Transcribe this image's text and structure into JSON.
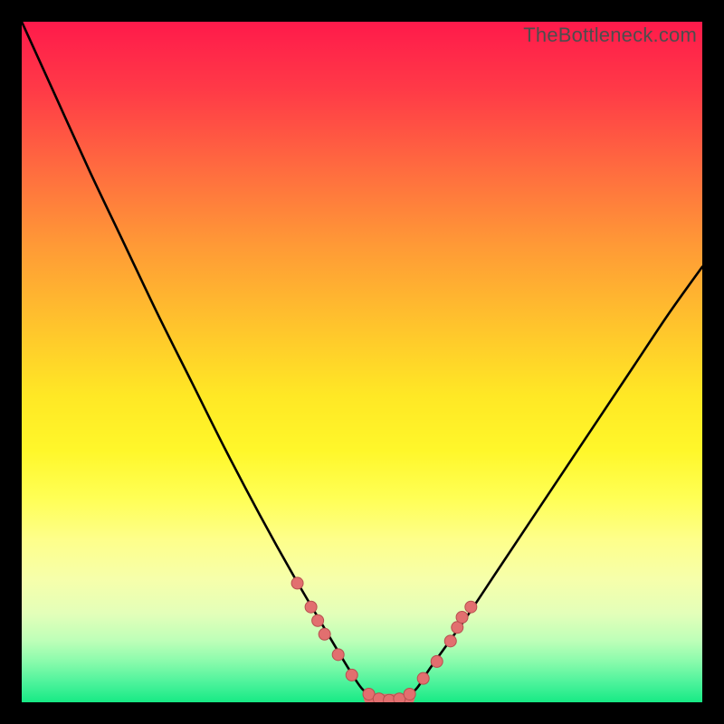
{
  "watermark": "TheBottleneck.com",
  "colors": {
    "frame": "#000000",
    "curve_stroke": "#000000",
    "marker_fill": "#e26f6f",
    "marker_stroke": "#b74f4f"
  },
  "chart_data": {
    "type": "line",
    "title": "",
    "xlabel": "",
    "ylabel": "",
    "xlim": [
      0,
      100
    ],
    "ylim": [
      0,
      100
    ],
    "note": "Axes are percentage-normalized to the plot frame (0=left/bottom, 100=right/top). No tick labels or axis text are present in the image; all numeric values are visual estimates.",
    "series": [
      {
        "name": "bottleneck-curve",
        "x": [
          0,
          5,
          10,
          15,
          20,
          25,
          30,
          35,
          40,
          45,
          48,
          50,
          52,
          54,
          56,
          58,
          60,
          65,
          70,
          75,
          80,
          85,
          90,
          95,
          100
        ],
        "y": [
          100,
          89,
          78,
          67.5,
          57,
          47,
          37,
          27.5,
          18.5,
          10,
          5,
          2,
          0.5,
          0,
          0.5,
          2,
          5,
          12,
          19.5,
          27,
          34.5,
          42,
          49.5,
          57,
          64
        ]
      }
    ],
    "markers": {
      "name": "highlighted-points",
      "points": [
        {
          "x": 40.5,
          "y": 17.5
        },
        {
          "x": 42.5,
          "y": 14
        },
        {
          "x": 43.5,
          "y": 12
        },
        {
          "x": 44.5,
          "y": 10
        },
        {
          "x": 46.5,
          "y": 7
        },
        {
          "x": 48.5,
          "y": 4
        },
        {
          "x": 51,
          "y": 1.2
        },
        {
          "x": 52.5,
          "y": 0.5
        },
        {
          "x": 54,
          "y": 0.3
        },
        {
          "x": 55.5,
          "y": 0.5
        },
        {
          "x": 57,
          "y": 1.2
        },
        {
          "x": 59,
          "y": 3.5
        },
        {
          "x": 61,
          "y": 6
        },
        {
          "x": 63,
          "y": 9
        },
        {
          "x": 64,
          "y": 11
        },
        {
          "x": 64.7,
          "y": 12.5
        },
        {
          "x": 66,
          "y": 14
        }
      ]
    },
    "flat_segment": {
      "x_start": 51,
      "x_end": 57,
      "y": 0.5
    }
  }
}
